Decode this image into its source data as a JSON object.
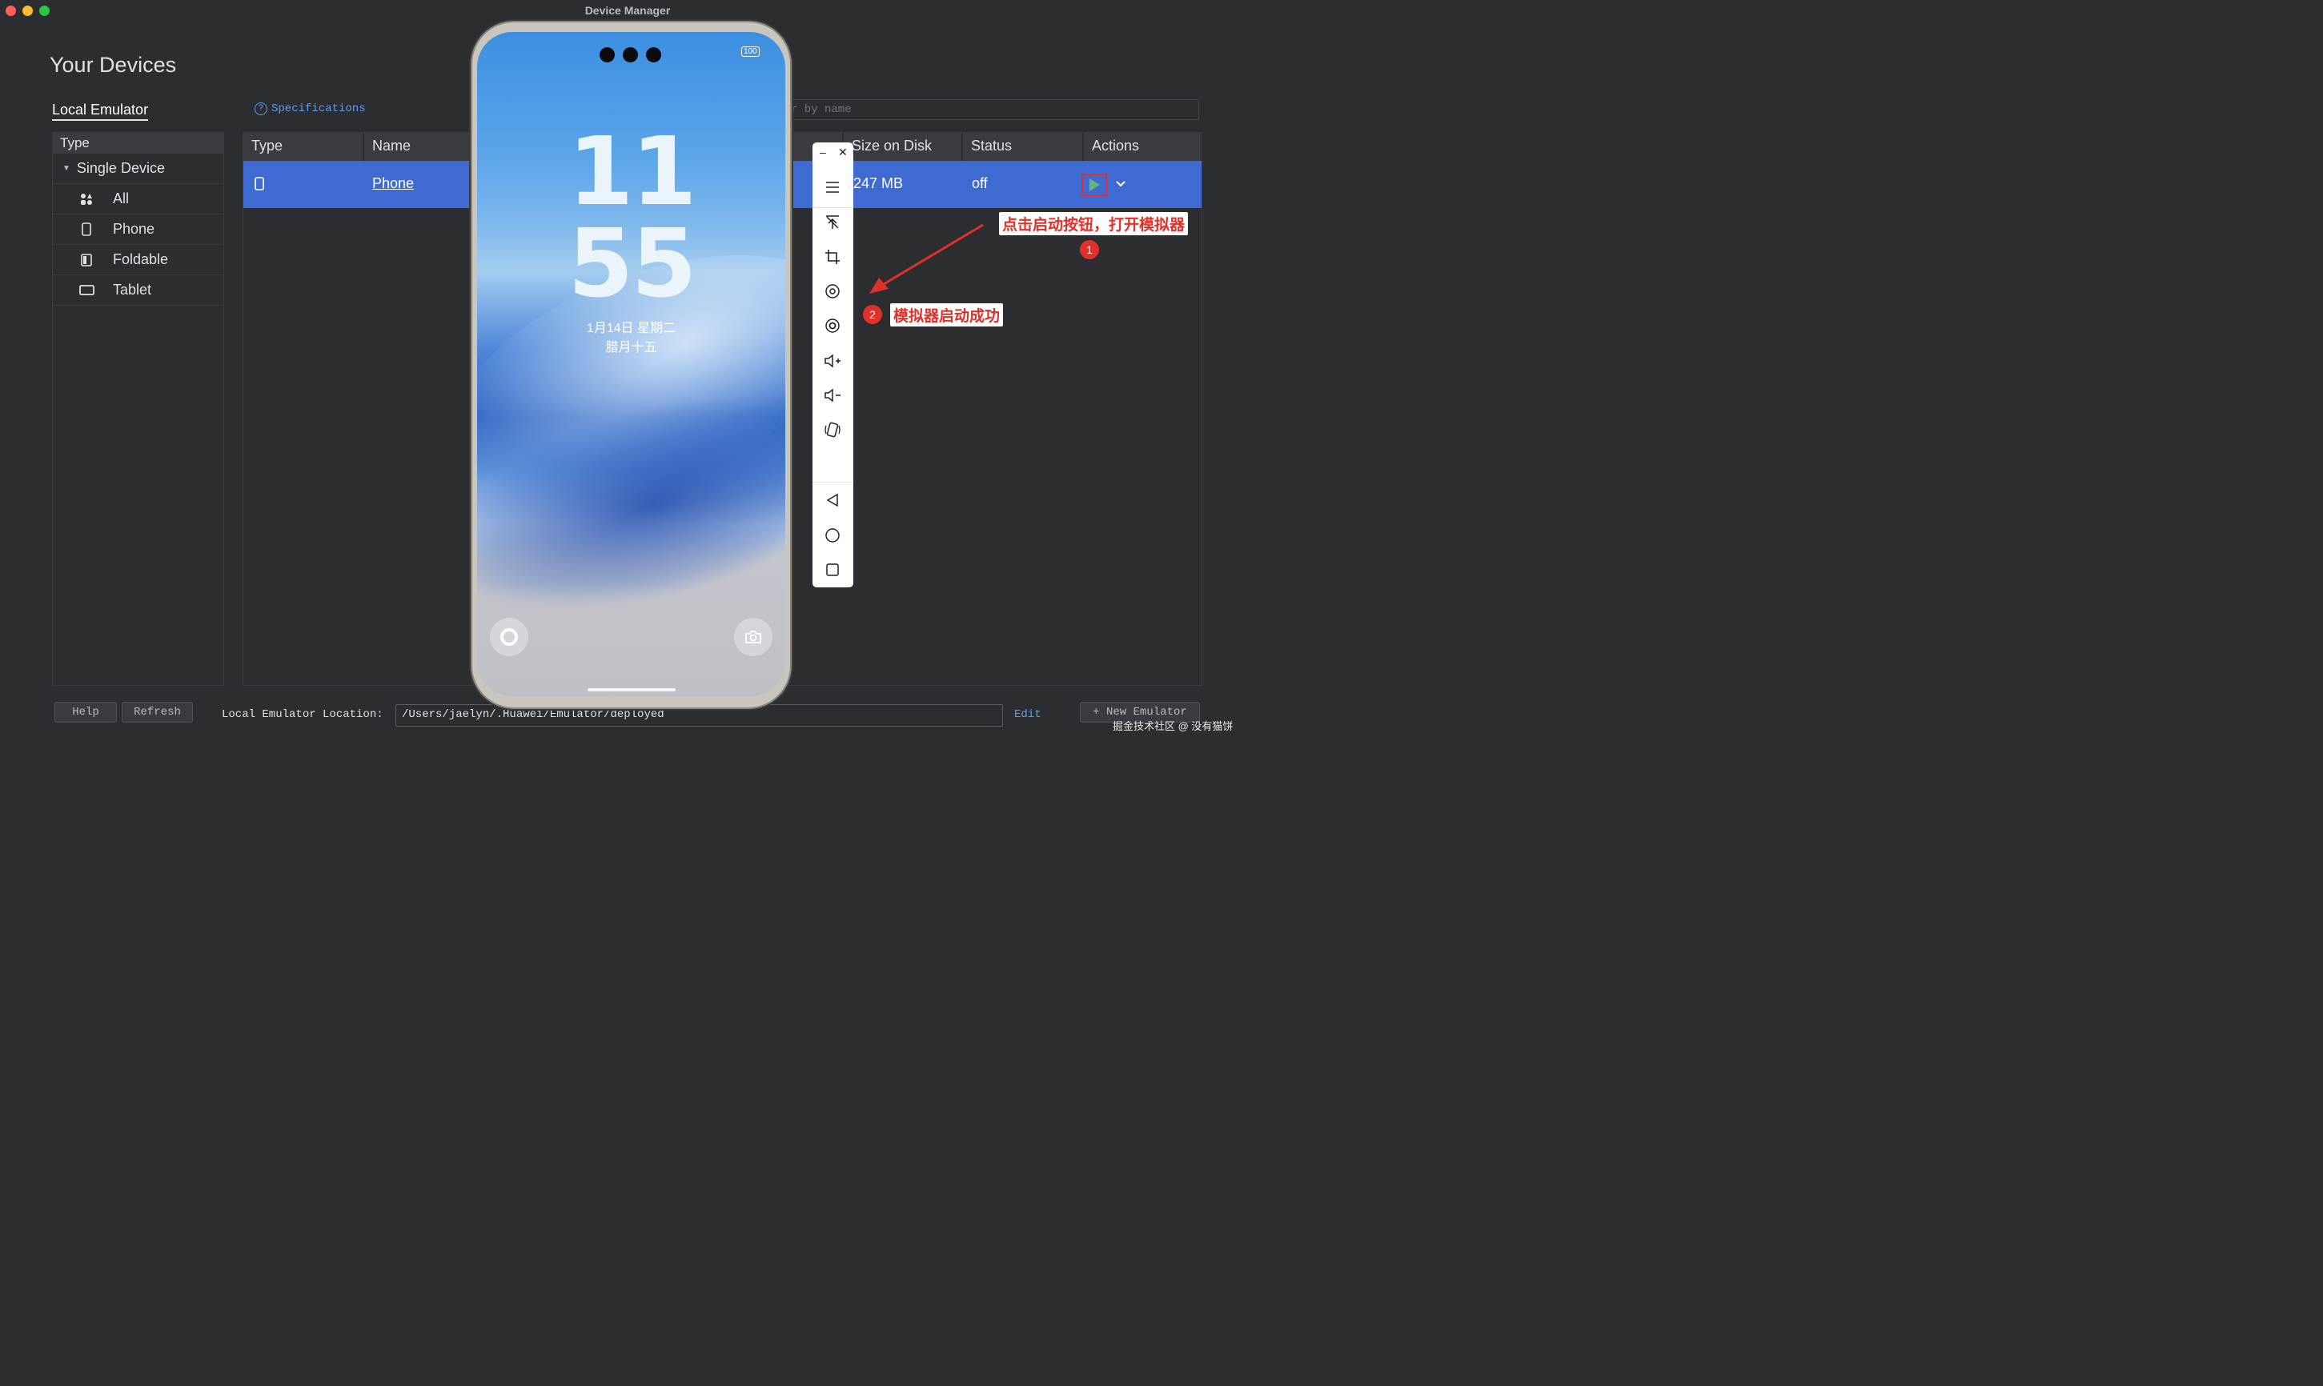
{
  "window": {
    "title": "Device Manager"
  },
  "page_title": "Your Devices",
  "tabs": {
    "local_emulator": "Local Emulator",
    "specifications": "Specifications"
  },
  "search": {
    "placeholder_visible": "r by name"
  },
  "sidebar": {
    "header": "Type",
    "group": "Single Device",
    "items": [
      {
        "label": "All",
        "icon": "grid-icon"
      },
      {
        "label": "Phone",
        "icon": "phone-icon"
      },
      {
        "label": "Foldable",
        "icon": "foldable-icon"
      },
      {
        "label": "Tablet",
        "icon": "tablet-icon"
      }
    ]
  },
  "table": {
    "columns": [
      "Type",
      "Name",
      "Size on Disk",
      "Status",
      "Actions"
    ],
    "rows": [
      {
        "type_icon": "phone-icon",
        "name": "Phone",
        "size": "247 MB",
        "status": "off"
      }
    ]
  },
  "footer": {
    "help": "Help",
    "refresh": "Refresh",
    "location_label": "Local Emulator Location:",
    "location_value": "/Users/jaelyn/.Huawei/Emulator/deployed",
    "edit": "Edit",
    "new_emulator": "New Emulator"
  },
  "emulator": {
    "battery": "100",
    "clock_hours": "11",
    "clock_minutes": "55",
    "date_line1": "1月14日 星期二",
    "date_line2": "腊月十五"
  },
  "annotations": {
    "step1_text": "点击启动按钮，打开模拟器",
    "step1_num": "1",
    "step2_text": "模拟器启动成功",
    "step2_num": "2",
    "color": "#e0302a"
  },
  "watermark": "掘金技术社区 @ 没有猫饼",
  "colors": {
    "accent": "#3e6ad2",
    "link": "#5c9cf5",
    "play": "#5fb878",
    "background": "#2b2d30"
  }
}
